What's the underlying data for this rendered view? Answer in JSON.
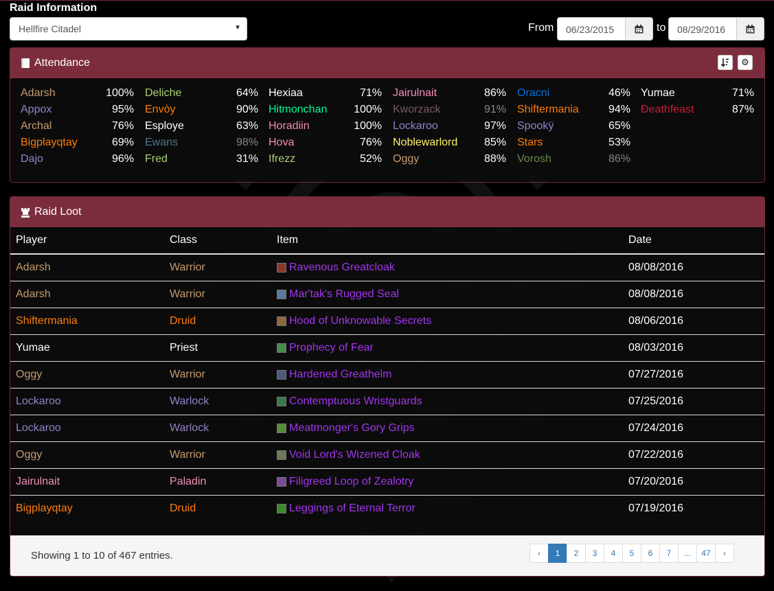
{
  "header": {
    "title": "Raid Information",
    "raid_selected": "Hellfire Citadel",
    "from_label": "From",
    "to_label": "to",
    "from_date": "06/23/2015",
    "to_date": "08/29/2016"
  },
  "colors": {
    "panel_header": "#7b2d3e",
    "item_epic": "#a335ee",
    "page_active": "#337ab7"
  },
  "attendance": {
    "title": "Attendance",
    "icons": {
      "panel": "book-icon",
      "sort": "sort-icon",
      "settings": "gear-icon"
    },
    "columns": [
      [
        {
          "name": "Adarsh",
          "pct": "100%",
          "color": "#c79c6e"
        },
        {
          "name": "Appox",
          "pct": "95%",
          "color": "#9482c9"
        },
        {
          "name": "Archal",
          "pct": "76%",
          "color": "#c79c6e"
        },
        {
          "name": "Bigplayqtay",
          "pct": "69%",
          "color": "#ff7d0a"
        },
        {
          "name": "Dajo",
          "pct": "96%",
          "color": "#9482c9"
        }
      ],
      [
        {
          "name": "Deliche",
          "pct": "64%",
          "color": "#abd473"
        },
        {
          "name": "Envòy",
          "pct": "90%",
          "color": "#ff7d0a"
        },
        {
          "name": "Esploye",
          "pct": "63%",
          "color": "#ffffff"
        },
        {
          "name": "Ewans",
          "pct": "98%",
          "color": "#4a7a8c",
          "pct_color": "#888888"
        },
        {
          "name": "Fred",
          "pct": "31%",
          "color": "#abd473"
        }
      ],
      [
        {
          "name": "Hexiaa",
          "pct": "71%",
          "color": "#ffffff"
        },
        {
          "name": "Hitmonchan",
          "pct": "100%",
          "color": "#00ff96"
        },
        {
          "name": "Horadiin",
          "pct": "100%",
          "color": "#f58cba"
        },
        {
          "name": "Hova",
          "pct": "76%",
          "color": "#f58cba"
        },
        {
          "name": "Ifrezz",
          "pct": "52%",
          "color": "#abd473"
        }
      ],
      [
        {
          "name": "Jairulnait",
          "pct": "86%",
          "color": "#f58cba"
        },
        {
          "name": "Kworzack",
          "pct": "91%",
          "color": "#7a5a6a",
          "pct_color": "#888888"
        },
        {
          "name": "Lockaroo",
          "pct": "97%",
          "color": "#9482c9"
        },
        {
          "name": "Noblewarlord",
          "pct": "85%",
          "color": "#fff569"
        },
        {
          "name": "Oggy",
          "pct": "88%",
          "color": "#c79c6e"
        }
      ],
      [
        {
          "name": "Oracni",
          "pct": "46%",
          "color": "#0070de"
        },
        {
          "name": "Shiftermania",
          "pct": "94%",
          "color": "#ff7d0a"
        },
        {
          "name": "Spookÿ",
          "pct": "65%",
          "color": "#9482c9"
        },
        {
          "name": "Stars",
          "pct": "53%",
          "color": "#ff7d0a"
        },
        {
          "name": "Vorosh",
          "pct": "86%",
          "color": "#6a8a4a",
          "pct_color": "#888888"
        }
      ],
      [
        {
          "name": "Yumae",
          "pct": "71%",
          "color": "#ffffff"
        },
        {
          "name": "Ðeathfeast",
          "pct": "87%",
          "color": "#c41f3b"
        }
      ]
    ]
  },
  "loot": {
    "title": "Raid Loot",
    "icon": "rook-icon",
    "columns": [
      "Player",
      "Class",
      "Item",
      "Date"
    ],
    "rows": [
      {
        "player": "Adarsh",
        "class": "Warrior",
        "item": "Ravenous Greatcloak",
        "date": "08/08/2016",
        "color": "#c79c6e",
        "icon_color": "#8a3a2a"
      },
      {
        "player": "Adarsh",
        "class": "Warrior",
        "item": "Mar'tak's Rugged Seal",
        "date": "08/08/2016",
        "color": "#c79c6e",
        "icon_color": "#5a7a9a"
      },
      {
        "player": "Shiftermania",
        "class": "Druid",
        "item": "Hood of Unknowable Secrets",
        "date": "08/06/2016",
        "color": "#ff7d0a",
        "icon_color": "#8a6a3a"
      },
      {
        "player": "Yumae",
        "class": "Priest",
        "item": "Prophecy of Fear",
        "date": "08/03/2016",
        "color": "#ffffff",
        "icon_color": "#4a8a4a"
      },
      {
        "player": "Oggy",
        "class": "Warrior",
        "item": "Hardened Greathelm",
        "date": "07/27/2016",
        "color": "#c79c6e",
        "icon_color": "#4a5a7a"
      },
      {
        "player": "Lockaroo",
        "class": "Warlock",
        "item": "Contemptuous Wristguards",
        "date": "07/25/2016",
        "color": "#9482c9",
        "icon_color": "#3a7a4a"
      },
      {
        "player": "Lockaroo",
        "class": "Warlock",
        "item": "Meatmonger's Gory Grips",
        "date": "07/24/2016",
        "color": "#9482c9",
        "icon_color": "#5a8a3a"
      },
      {
        "player": "Oggy",
        "class": "Warrior",
        "item": "Void Lord's Wizened Cloak",
        "date": "07/22/2016",
        "color": "#c79c6e",
        "icon_color": "#6a7a5a"
      },
      {
        "player": "Jairulnait",
        "class": "Paladin",
        "item": "Filigreed Loop of Zealotry",
        "date": "07/20/2016",
        "color": "#f58cba",
        "icon_color": "#7a4a9a"
      },
      {
        "player": "Bigplayqtay",
        "class": "Druid",
        "item": "Leggings of Eternal Terror",
        "date": "07/19/2016",
        "color": "#ff7d0a",
        "icon_color": "#3a8a2a"
      }
    ],
    "showing": "Showing 1 to 10 of 467 entries.",
    "pagination": [
      "‹",
      "1",
      "2",
      "3",
      "4",
      "5",
      "6",
      "7",
      "...",
      "47",
      "›"
    ],
    "current_page": "1"
  }
}
